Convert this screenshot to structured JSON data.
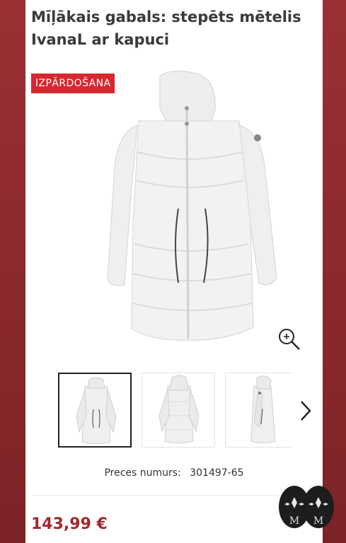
{
  "product": {
    "title": "Mīļākais gabals: stepēts mētelis IvanaL ar kapuci",
    "sale_badge": "IZPĀRDOŠANA",
    "sku_label": "Preces numurs:",
    "sku_value": "301497-65",
    "price": "143,99 €"
  },
  "gallery": {
    "thumbnails": [
      "front-view",
      "back-view",
      "side-view"
    ],
    "active_index": 0
  },
  "icons": {
    "zoom": "zoom-in-icon",
    "next": "chevron-right-icon",
    "brand": "brand-logo"
  },
  "colors": {
    "sale": "#d7282f",
    "price": "#a2282e",
    "background": "#8b2a2e"
  }
}
